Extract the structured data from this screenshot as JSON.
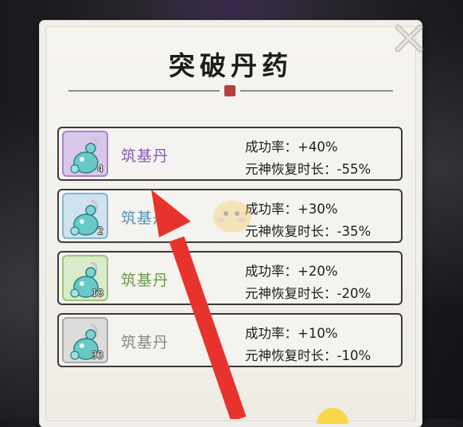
{
  "dialog": {
    "title": "突破丹药",
    "close_icon": "close-x-icon",
    "accent_seal_color": "#b0413e"
  },
  "items": [
    {
      "name": "筑基丹",
      "count": "4",
      "quality_color": "#8b5bb5",
      "icon_bg": "#d9c7ea",
      "icon_border": "#a784c7",
      "icon": "gourd-pill-icon",
      "stat1": "成功率：+40%",
      "stat2": "元神恢复时长：-55%"
    },
    {
      "name": "筑基丹",
      "count": "2",
      "quality_color": "#5a92b8",
      "icon_bg": "#cfe3ee",
      "icon_border": "#86b4cd",
      "icon": "gourd-pill-icon",
      "stat1": "成功率：+30%",
      "stat2": "元神恢复时长：-35%"
    },
    {
      "name": "筑基丹",
      "count": "18",
      "quality_color": "#6e9a4a",
      "icon_bg": "#d9ebc8",
      "icon_border": "#9cc47c",
      "icon": "gourd-pill-icon",
      "stat1": "成功率：+20%",
      "stat2": "元神恢复时长：-20%"
    },
    {
      "name": "筑基丹",
      "count": "33",
      "quality_color": "#8a8a8a",
      "icon_bg": "#dcdcdc",
      "icon_border": "#a8a8a8",
      "icon": "gourd-pill-icon",
      "stat1": "成功率：+10%",
      "stat2": "元神恢复时长：-10%"
    }
  ],
  "annotation": {
    "arrow_color": "#e8322c",
    "arrow_icon": "red-pointer-arrow"
  }
}
